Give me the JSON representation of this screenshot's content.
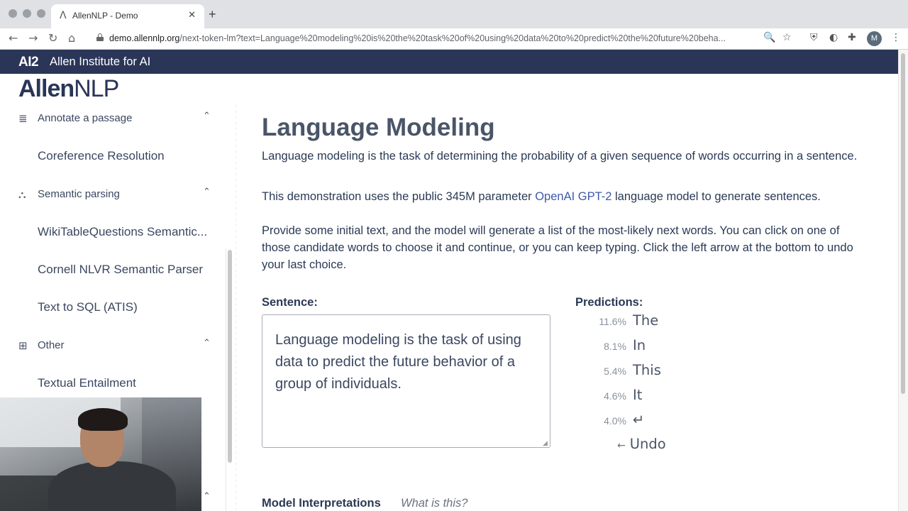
{
  "browser": {
    "tab_title": "AllenNLP - Demo",
    "tab_favicon": "Λ",
    "close": "✕",
    "new_tab": "+",
    "url_host": "demo.allennlp.org",
    "url_path": "/next-token-lm?text=Language%20modeling%20is%20the%20task%20of%20using%20data%20to%20predict%20the%20future%20beha...",
    "avatar_letter": "M",
    "nav": {
      "back": "←",
      "forward": "→",
      "reload": "↻",
      "home": "⌂"
    },
    "icons": {
      "zoom": "🔍",
      "star": "☆",
      "ext1": "⛨",
      "ext2": "◐",
      "ext3": "✚",
      "menu": "⋮"
    }
  },
  "banner": {
    "logo": "AI2",
    "name": "Allen Institute for AI"
  },
  "brand": {
    "allen": "Allen",
    "nlp": "NLP"
  },
  "sidebar": {
    "groups": [
      {
        "label": "Annotate a passage",
        "icon": "≣",
        "chevron": "⌃"
      },
      {
        "label": "Semantic parsing",
        "icon": "⛬",
        "chevron": "⌃"
      },
      {
        "label": "Other",
        "icon": "⊞",
        "chevron": "⌃"
      }
    ],
    "items": [
      "Coreference Resolution",
      "WikiTableQuestions Semantic...",
      "Cornell NLVR Semantic Parser",
      "Text to SQL (ATIS)",
      "Textual Entailment"
    ],
    "bottom_chevron": "⌃"
  },
  "main": {
    "title": "Language Modeling",
    "desc1": "Language modeling is the task of determining the probability of a given sequence of words occurring in a sentence.",
    "desc2_pre": "This demonstration uses the public 345M parameter ",
    "desc2_link": "OpenAI GPT-2",
    "desc2_post": " language model to generate sentences.",
    "desc3": "Provide some initial text, and the model will generate a list of the most-likely next words. You can click on one of those candidate words to choose it and continue, or you can keep typing. Click the left arrow at the bottom to undo your last choice.",
    "sentence_label": "Sentence:",
    "sentence_value": "Language modeling is the task of using data to predict the future behavior of a group of individuals.",
    "predictions_label": "Predictions:",
    "predictions": [
      {
        "pct": "11.6%",
        "word": "The"
      },
      {
        "pct": "8.1%",
        "word": "In"
      },
      {
        "pct": "5.4%",
        "word": "This"
      },
      {
        "pct": "4.6%",
        "word": "It"
      },
      {
        "pct": "4.0%",
        "word": "↵"
      }
    ],
    "undo_arrow": "←",
    "undo_label": "Undo",
    "interp_label": "Model Interpretations",
    "interp_help": "What is this?"
  }
}
